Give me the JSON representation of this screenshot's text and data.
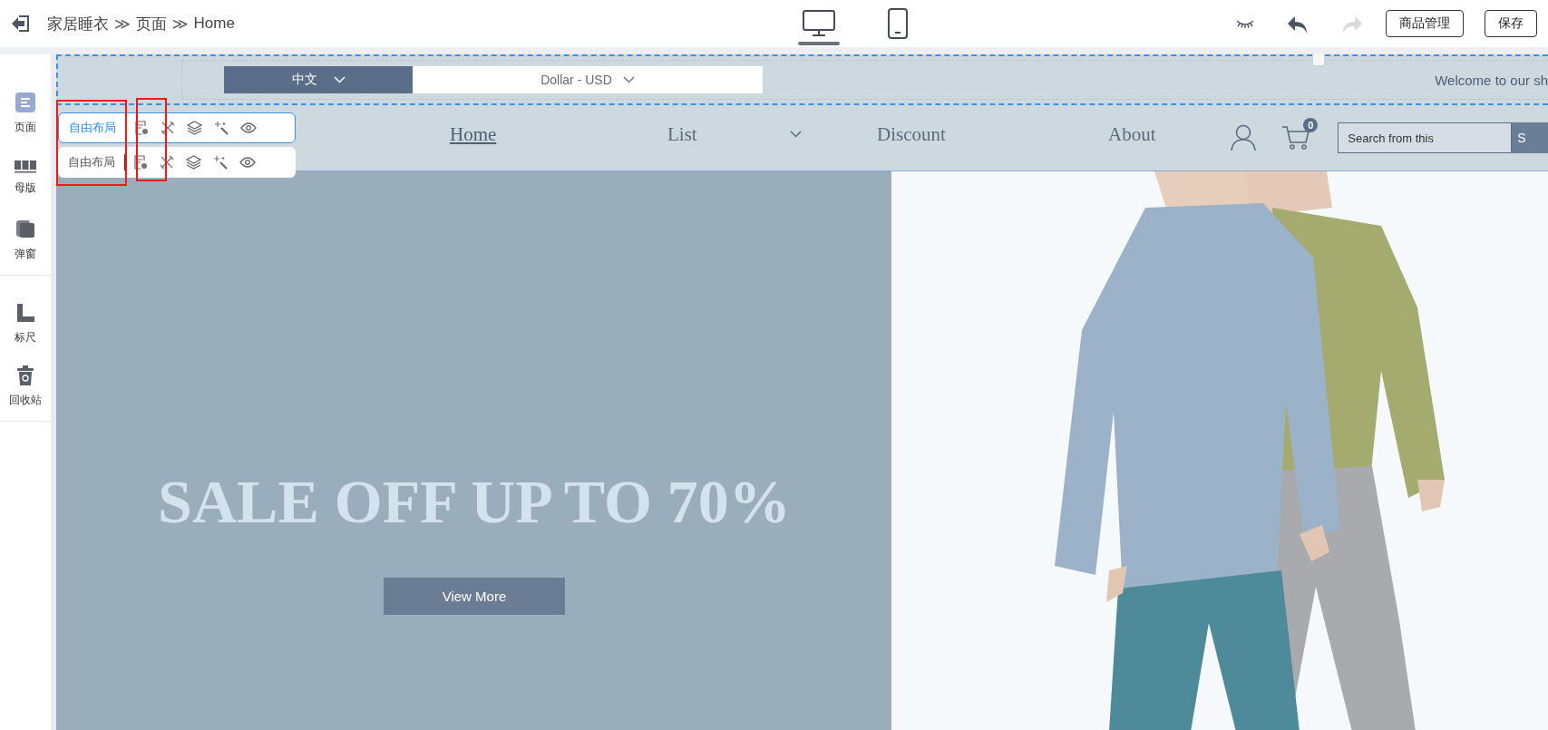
{
  "header": {
    "breadcrumb": [
      {
        "label": "家居睡衣",
        "separator": "≫"
      },
      {
        "label": "页面",
        "separator": "≫"
      },
      {
        "label": "Home"
      }
    ],
    "devices": [
      {
        "kind": "desktop",
        "selected": true
      },
      {
        "kind": "mobile",
        "selected": false
      }
    ],
    "history": [
      {
        "kind": "undo",
        "disabled": false
      },
      {
        "kind": "redo",
        "disabled": true
      }
    ],
    "buttons": [
      "商品管理",
      "保存"
    ]
  },
  "sidebar": {
    "groups": [
      [
        {
          "label": "页面",
          "kind": "page",
          "selected": true
        },
        {
          "label": "母版",
          "kind": "master",
          "selected": false
        },
        {
          "label": "弹窗",
          "kind": "popup",
          "selected": false
        }
      ],
      [
        {
          "label": "标尺",
          "kind": "ruler",
          "selected": false
        },
        {
          "label": "回收站",
          "kind": "trash",
          "selected": false
        }
      ]
    ]
  },
  "top_strip": {
    "language": "中文",
    "currency": "Dollar - USD",
    "welcome": "Welcome to our sh"
  },
  "nav": {
    "items": [
      {
        "label": "Home",
        "selected": true,
        "dropdown": false
      },
      {
        "label": "List",
        "selected": false,
        "dropdown": true
      },
      {
        "label": "Discount",
        "selected": false,
        "dropdown": false
      },
      {
        "label": "About",
        "selected": false,
        "dropdown": false
      }
    ],
    "cart_count": "0",
    "search": {
      "placeholder": "Search from this",
      "button": "S"
    }
  },
  "toolbars": [
    {
      "label": "自由布局",
      "selected": true
    },
    {
      "label": "自由布局",
      "selected": false
    }
  ],
  "hero": {
    "headline": "SALE OFF UP TO 70%",
    "button": "View More"
  }
}
